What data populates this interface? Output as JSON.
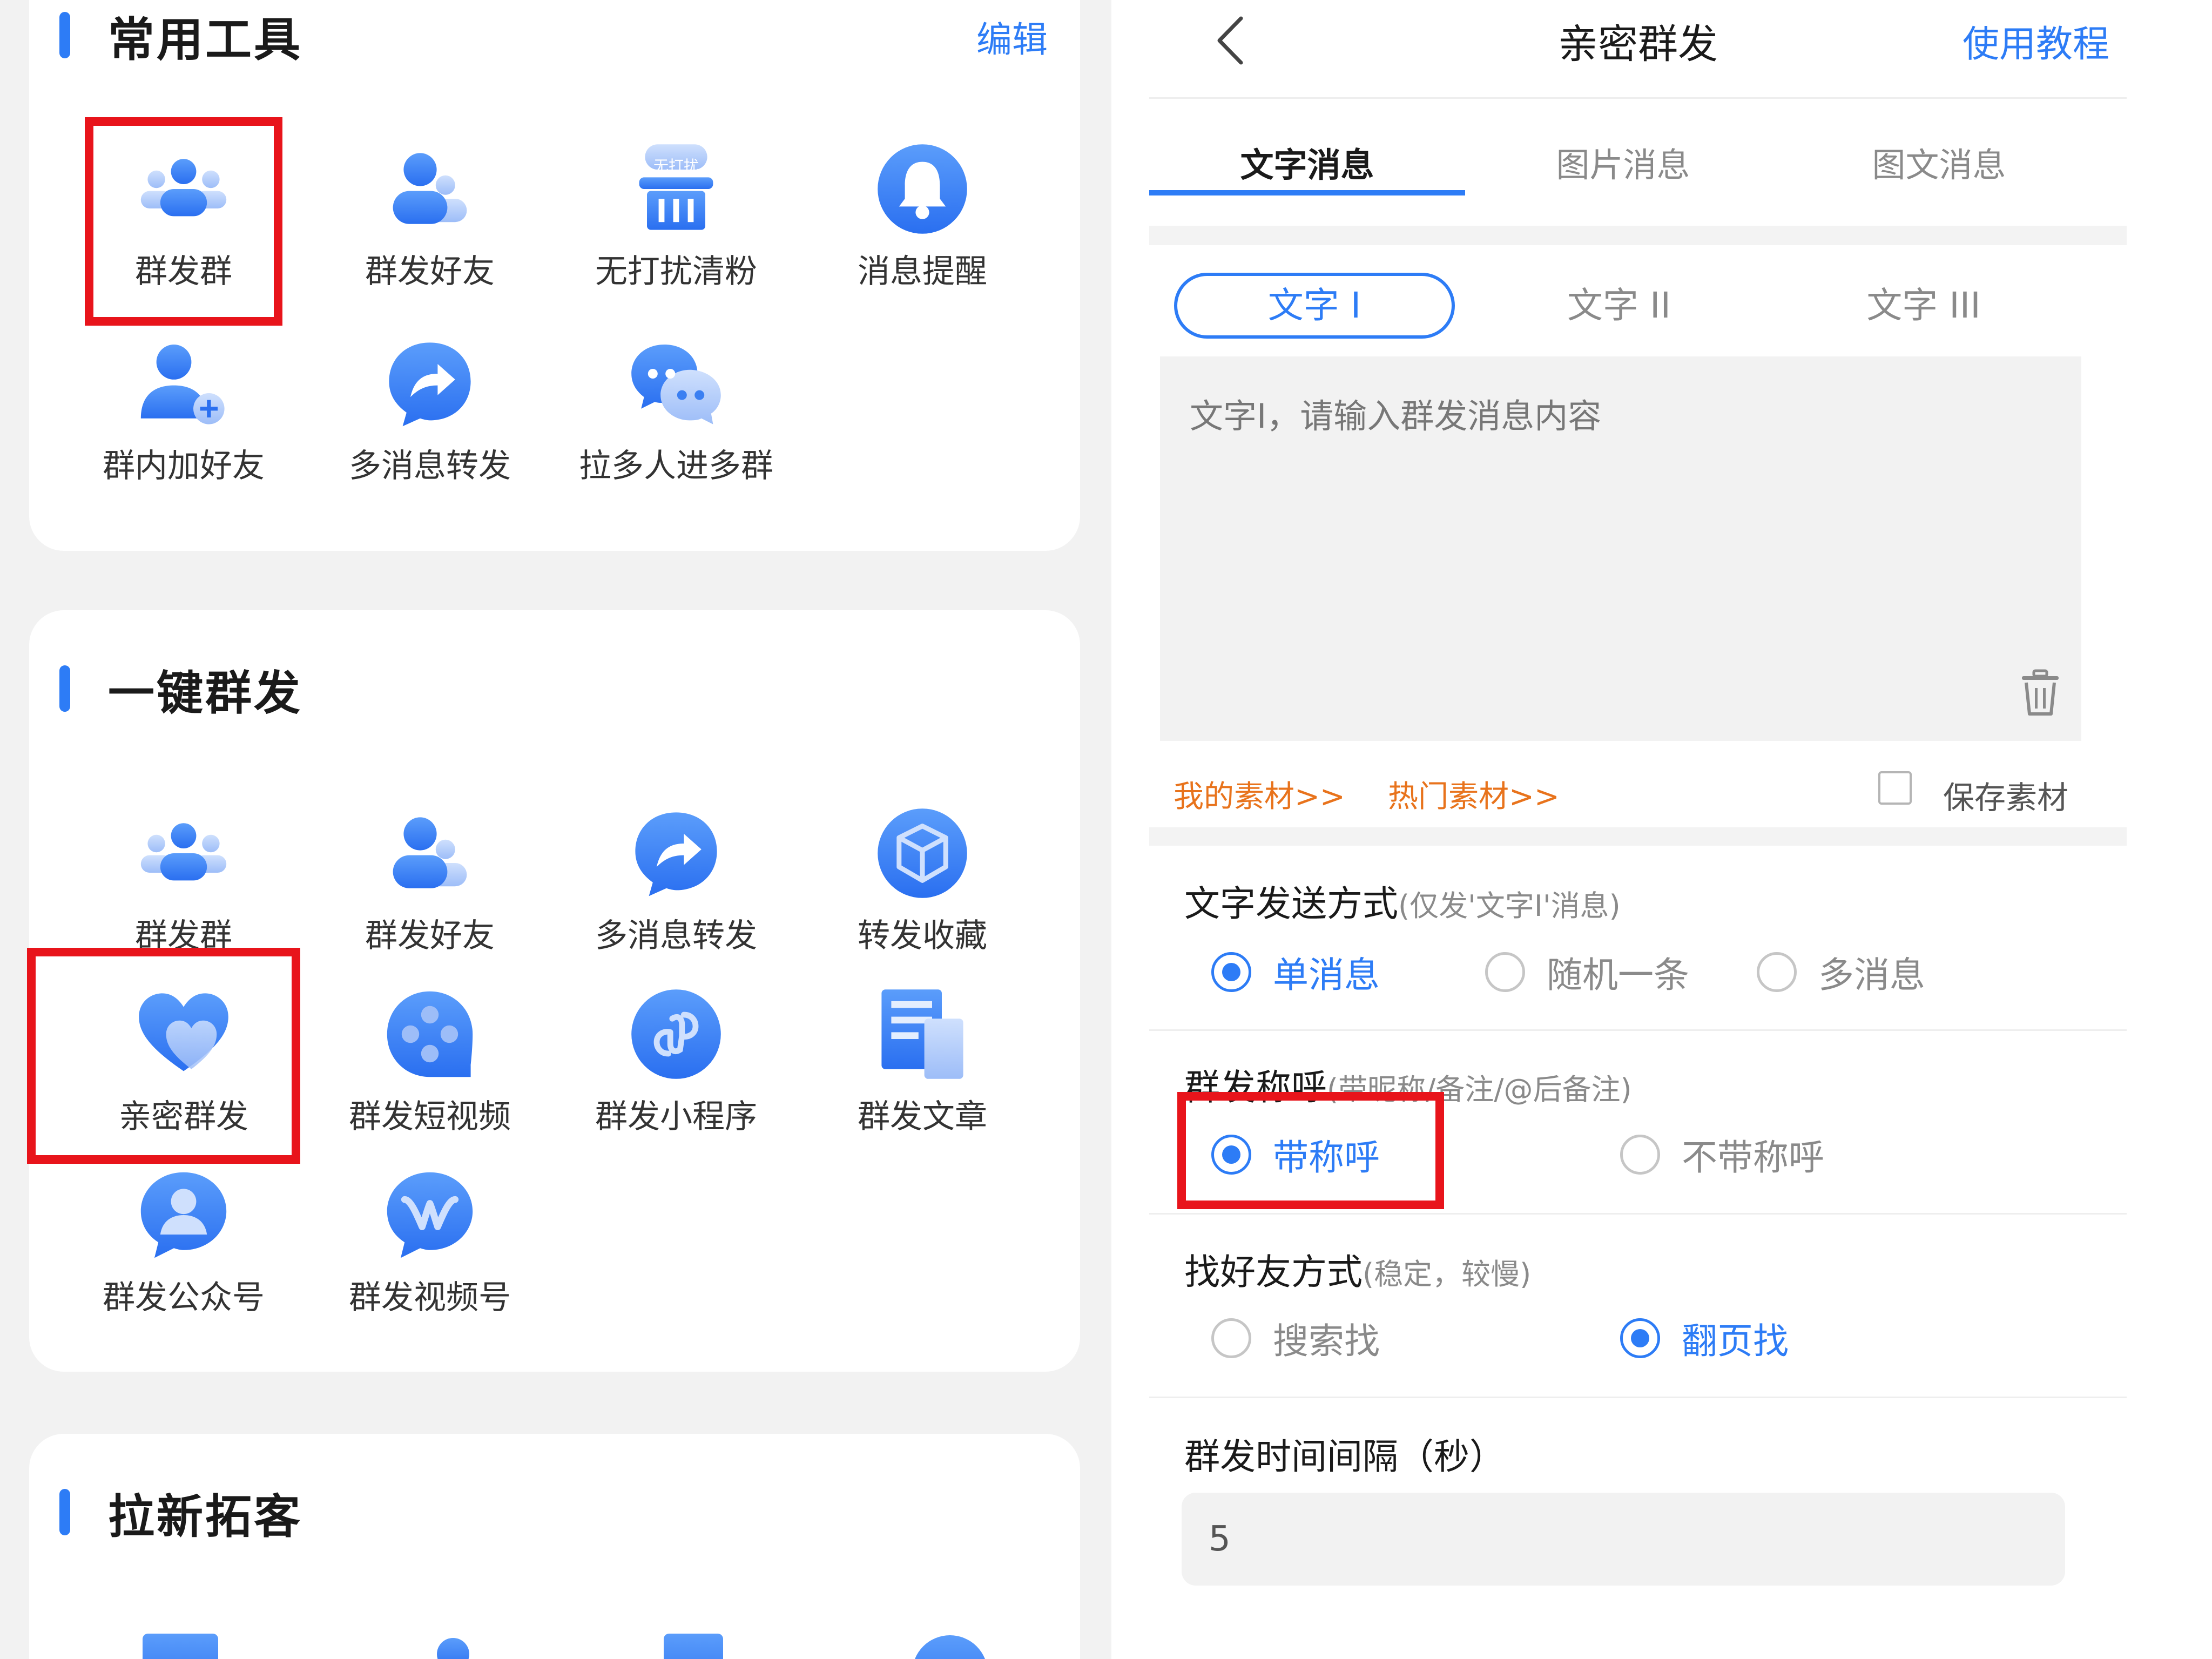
{
  "left_panel": {
    "common_tools": {
      "title": "常用工具",
      "edit_label": "编辑",
      "items": [
        "群发群",
        "群发好友",
        "无打扰清粉",
        "消息提醒",
        "群内加好友",
        "多消息转发",
        "拉多人进多群"
      ],
      "badge_text": "无打扰"
    },
    "one_click": {
      "title": "一键群发",
      "items": [
        "群发群",
        "群发好友",
        "多消息转发",
        "转发收藏",
        "亲密群发",
        "群发短视频",
        "群发小程序",
        "群发文章",
        "群发公众号",
        "群发视频号"
      ]
    },
    "new_customers": {
      "title": "拉新拓客"
    }
  },
  "right_panel": {
    "title": "亲密群发",
    "tutorial_label": "使用教程",
    "tabs": [
      "文字消息",
      "图片消息",
      "图文消息"
    ],
    "active_tab": 0,
    "text_tabs": [
      "文字 I",
      "文字 II",
      "文字 III"
    ],
    "active_text_tab": 0,
    "message_input": {
      "value": "",
      "placeholder": "文字I，请输入群发消息内容"
    },
    "my_materials": "我的素材>>",
    "hot_materials": "热门素材>>",
    "save_material": "保存素材",
    "send_mode": {
      "title": "文字发送方式",
      "note": "(仅发'文字I'消息)",
      "options": [
        "单消息",
        "随机一条",
        "多消息"
      ],
      "selected": 0
    },
    "greeting": {
      "title": "群发称呼",
      "note": "(带昵称/备注/@后备注)",
      "options": [
        "带称呼",
        "不带称呼"
      ],
      "selected": 0
    },
    "find_friends": {
      "title": "找好友方式",
      "note": "(稳定，较慢)",
      "options": [
        "搜索找",
        "翻页找"
      ],
      "selected": 1
    },
    "interval": {
      "title": "群发时间间隔（秒）",
      "value": "5"
    }
  },
  "colors": {
    "accent": "#2d7cf6",
    "highlight_box": "#e8141b",
    "material_link": "#e8731c",
    "icon_light": "#a9c8fb"
  }
}
